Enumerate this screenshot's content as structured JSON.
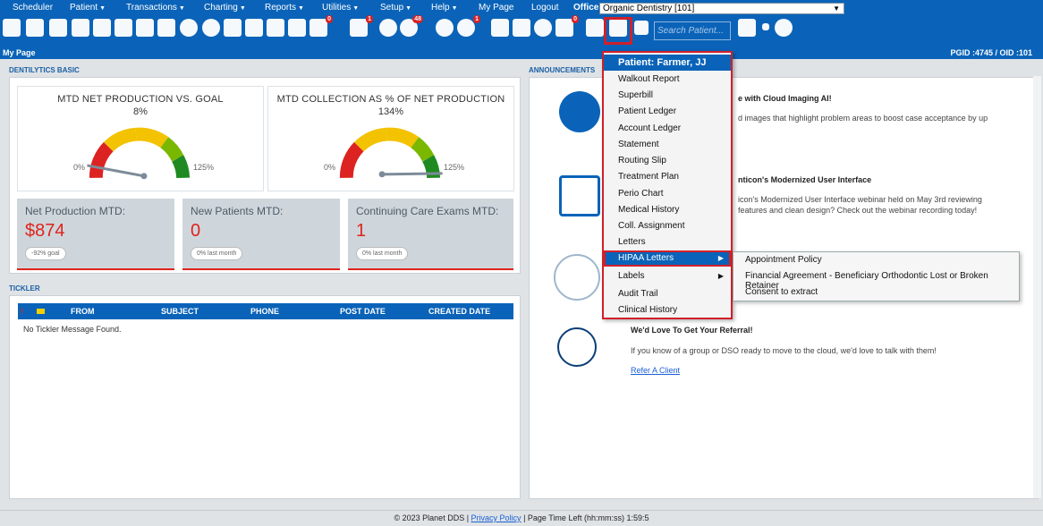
{
  "menubar": {
    "items": [
      {
        "label": "Scheduler",
        "caret": false
      },
      {
        "label": "Patient",
        "caret": true
      },
      {
        "label": "Transactions",
        "caret": true
      },
      {
        "label": "Charting",
        "caret": true
      },
      {
        "label": "Reports",
        "caret": true
      },
      {
        "label": "Utilities",
        "caret": true
      },
      {
        "label": "Setup",
        "caret": true
      },
      {
        "label": "Help",
        "caret": true
      },
      {
        "label": "My Page",
        "caret": false
      },
      {
        "label": "Logout",
        "caret": false
      }
    ],
    "office_label": "Office",
    "office_value": "Organic Dentistry [101]"
  },
  "toolbar": {
    "badges": {
      "notes": "0",
      "sms": "1",
      "globe": "48",
      "refresh": "1",
      "tasks": "0"
    },
    "search_placeholder": "Search Patient..."
  },
  "titlebar": {
    "page": "My Page",
    "ids": "PGID :4745 / OID :101"
  },
  "dentilytics": {
    "title": "DENTILYTICS BASIC",
    "gauges": [
      {
        "title": "MTD NET PRODUCTION VS. GOAL",
        "pct": "8%",
        "min": "0%",
        "max": "125%",
        "value": 8
      },
      {
        "title": "MTD COLLECTION AS % OF NET PRODUCTION",
        "pct": "134%",
        "min": "0%",
        "max": "125%",
        "value": 134
      }
    ],
    "stats": [
      {
        "label": "Net Production MTD:",
        "value": "$874",
        "pill": "-92% goal"
      },
      {
        "label": "New Patients MTD:",
        "value": "0",
        "pill": "0% last month"
      },
      {
        "label": "Continuing Care Exams MTD:",
        "value": "1",
        "pill": "0% last month"
      }
    ]
  },
  "tickler": {
    "title": "TICKLER",
    "columns": [
      "FROM",
      "SUBJECT",
      "PHONE",
      "POST DATE",
      "CREATED DATE"
    ],
    "empty": "No Tickler Message Found."
  },
  "announcements": {
    "title": "ANNOUNCEMENTS",
    "items": [
      {
        "title": "e with Cloud Imaging AI!",
        "body": "d images that highlight problem areas to boost case acceptance by up"
      },
      {
        "title": "nticon's Modernized User Interface",
        "body": "icon's Modernized User Interface webinar held on May 3rd reviewing\nfeatures and clean design? Check out the webinar recording today!"
      },
      {
        "title": "We'd Love To Get Your Referral!",
        "body": "If you know of a group or DSO ready to move to the cloud, we'd love to talk with them!",
        "link": "Refer A Client"
      }
    ]
  },
  "print_menu": {
    "header": "Patient: Farmer, JJ",
    "items": [
      "Walkout Report",
      "Superbill",
      "Patient Ledger",
      "Account Ledger",
      "Statement",
      "Routing Slip",
      "Treatment Plan",
      "Perio Chart",
      "Medical History",
      "Coll. Assignment",
      "Letters",
      "HIPAA Letters",
      "Labels",
      "Audit Trail",
      "Clinical History"
    ],
    "submenu": [
      "Appointment Policy",
      "Financial Agreement - Beneficiary Orthodontic Lost or Broken Retainer",
      "Consent to extract"
    ]
  },
  "footer": {
    "copyright": "© 2023 Planet DDS |",
    "privacy": "Privacy Policy",
    "time": "| Page Time Left (hh:mm:ss) 1:59:5"
  },
  "colors": {
    "brand": "#0a63b8",
    "accent_red": "#e0231c",
    "highlight": "#d0202a"
  }
}
